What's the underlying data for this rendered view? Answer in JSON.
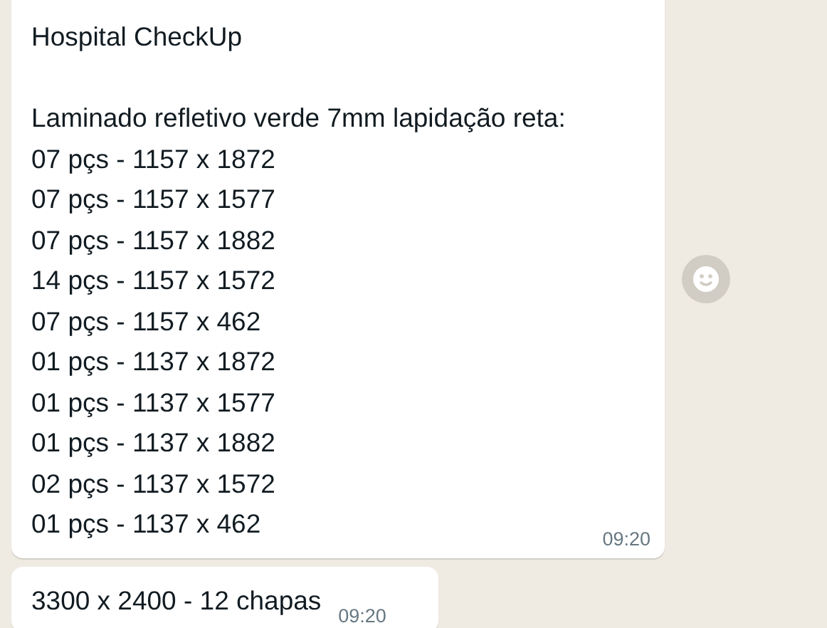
{
  "messages": [
    {
      "heading": "Hospital CheckUp",
      "subheading": "Laminado refletivo verde 7mm lapidação reta:",
      "items": [
        "07 pçs - 1157 x 1872",
        "07 pçs - 1157 x 1577",
        "07 pçs - 1157 x 1882",
        "14 pçs - 1157 x 1572",
        "07 pçs - 1157 x 462",
        "01 pçs - 1137 x 1872",
        "01 pçs - 1137 x 1577",
        "01 pçs - 1137 x 1882",
        "02 pçs - 1137 x 1572",
        "01 pçs - 1137 x 462"
      ],
      "time": "09:20"
    },
    {
      "text": "3300 x 2400 - 12 chapas",
      "time": "09:20"
    }
  ]
}
